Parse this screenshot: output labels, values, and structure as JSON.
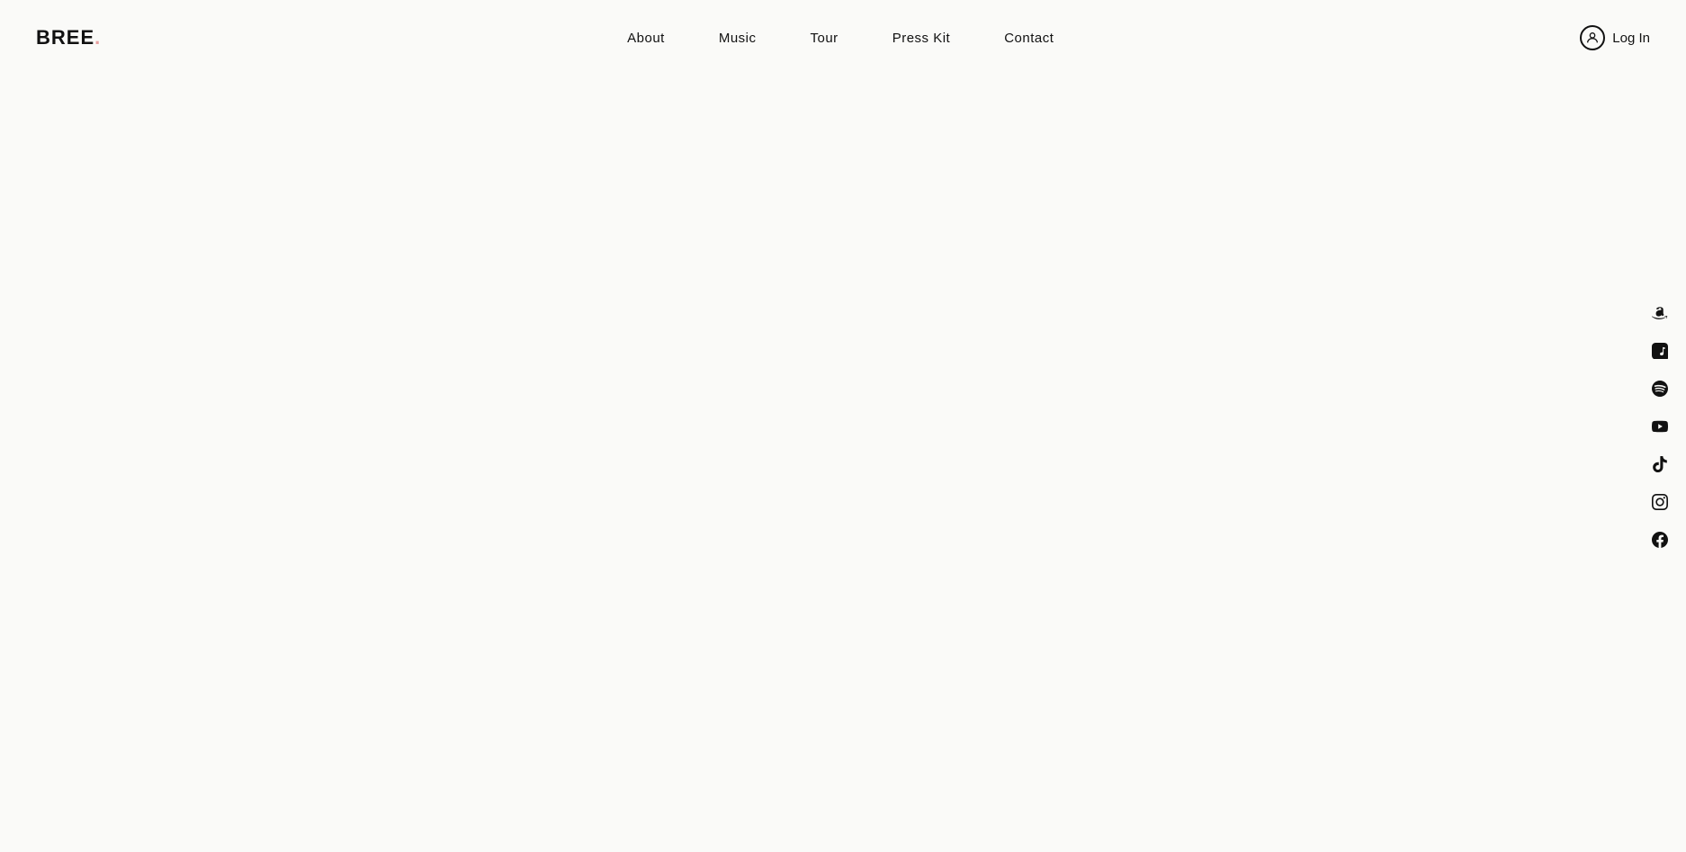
{
  "header": {
    "logo": {
      "text": "BREE",
      "dot": "."
    },
    "nav": {
      "items": [
        {
          "label": "About",
          "id": "about"
        },
        {
          "label": "Music",
          "id": "music"
        },
        {
          "label": "Tour",
          "id": "tour"
        },
        {
          "label": "Press Kit",
          "id": "press-kit"
        },
        {
          "label": "Contact",
          "id": "contact"
        }
      ]
    },
    "login": {
      "label": "Log In"
    }
  },
  "social": {
    "items": [
      {
        "id": "amazon-music",
        "label": "Amazon Music"
      },
      {
        "id": "apple-music",
        "label": "Apple Music"
      },
      {
        "id": "spotify",
        "label": "Spotify"
      },
      {
        "id": "youtube",
        "label": "YouTube"
      },
      {
        "id": "tiktok",
        "label": "TikTok"
      },
      {
        "id": "instagram",
        "label": "Instagram"
      },
      {
        "id": "facebook",
        "label": "Facebook"
      }
    ]
  }
}
